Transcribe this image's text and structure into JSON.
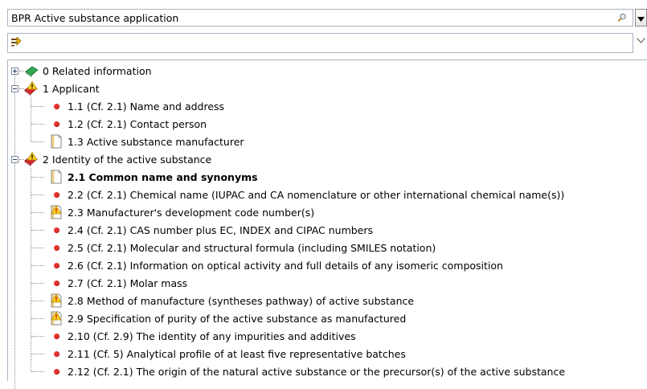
{
  "combo": {
    "value": "BPR Active substance application",
    "search_icon": "search-icon",
    "dropdown_icon": "chevron-down-icon"
  },
  "filter": {
    "icon": "filter-icon",
    "dropdown_icon": "chevron-down-icon"
  },
  "tree": [
    {
      "label": "0 Related information",
      "level": 0,
      "icon": "book-green-icon",
      "expander": "plus",
      "bold": false
    },
    {
      "label": "1 Applicant",
      "level": 0,
      "icon": "book-red-warning-icon",
      "expander": "minus",
      "bold": false
    },
    {
      "label": "1.1 (Cf. 2.1) Name and address",
      "level": 1,
      "icon": "red-dot-icon",
      "bold": false
    },
    {
      "label": "1.2 (Cf. 2.1) Contact person",
      "level": 1,
      "icon": "red-dot-icon",
      "bold": false
    },
    {
      "label": "1.3 Active substance manufacturer",
      "level": 1,
      "icon": "document-icon",
      "bold": false,
      "last": true
    },
    {
      "label": "2 Identity of the active substance",
      "level": 0,
      "icon": "book-red-warning-icon",
      "expander": "minus",
      "bold": false
    },
    {
      "label": "2.1 Common name and synonyms",
      "level": 1,
      "icon": "document-icon",
      "bold": true
    },
    {
      "label": "2.2 (Cf. 2.1) Chemical name (IUPAC and CA nomenclature or other international chemical name(s))",
      "level": 1,
      "icon": "red-dot-icon",
      "bold": false
    },
    {
      "label": "2.3 Manufacturer's development code number(s)",
      "level": 1,
      "icon": "document-warning-icon",
      "bold": false
    },
    {
      "label": "2.4 (Cf. 2.1) CAS number plus EC, INDEX and CIPAC numbers",
      "level": 1,
      "icon": "red-dot-icon",
      "bold": false
    },
    {
      "label": "2.5 (Cf. 2.1) Molecular and structural formula (including SMILES notation)",
      "level": 1,
      "icon": "red-dot-icon",
      "bold": false
    },
    {
      "label": "2.6 (Cf. 2.1) Information on optical activity and full details of any isomeric composition",
      "level": 1,
      "icon": "red-dot-icon",
      "bold": false
    },
    {
      "label": "2.7 (Cf. 2.1) Molar mass",
      "level": 1,
      "icon": "red-dot-icon",
      "bold": false
    },
    {
      "label": "2.8 Method of manufacture (syntheses pathway) of active substance",
      "level": 1,
      "icon": "document-warning-icon",
      "bold": false
    },
    {
      "label": "2.9 Specification of purity of the active substance as manufactured",
      "level": 1,
      "icon": "document-warning-icon",
      "bold": false
    },
    {
      "label": "2.10 (Cf. 2.9) The identity of any impurities and additives",
      "level": 1,
      "icon": "red-dot-icon",
      "bold": false
    },
    {
      "label": "2.11 (Cf. 5) Analytical profile of at least five representative batches",
      "level": 1,
      "icon": "red-dot-icon",
      "bold": false
    },
    {
      "label": "2.12 (Cf. 2.1) The origin of the natural active substance or the precursor(s) of the active substance",
      "level": 1,
      "icon": "red-dot-icon",
      "bold": false
    }
  ]
}
